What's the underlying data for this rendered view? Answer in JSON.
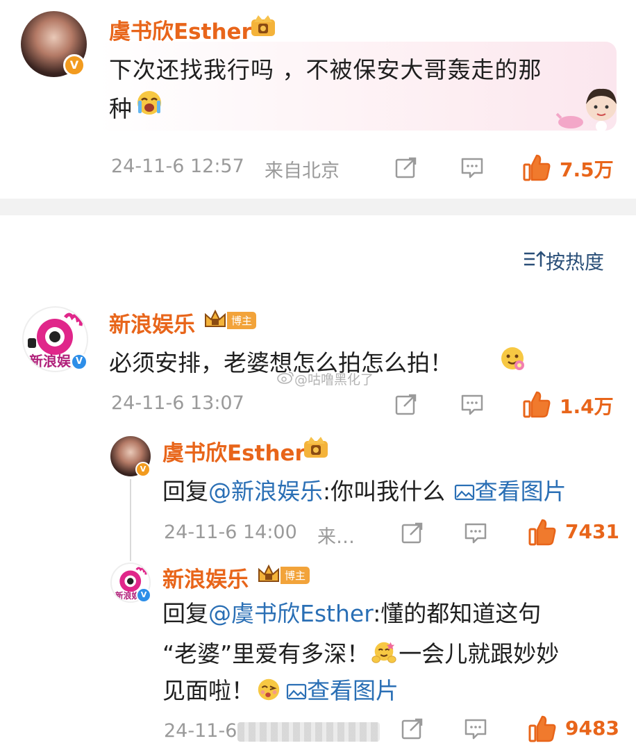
{
  "comments": [
    {
      "name": "虞书欣Esther",
      "text_line1": "下次还找我行吗 ，不被保安大哥轰走的那",
      "text_line2": "种",
      "time": "24-11-6 12:57",
      "location": "来自北京",
      "likes": "7.5万"
    },
    {
      "name": "新浪娱乐",
      "host_badge": "博主",
      "text": "必须安排，老婆想怎么拍怎么拍！",
      "time": "24-11-6 13:07",
      "likes": "1.4万"
    }
  ],
  "sort": {
    "label": "按热度"
  },
  "replies": [
    {
      "name": "虞书欣Esther",
      "reply_prefix": "回复",
      "mention": "@新浪娱乐",
      "text": ":你叫我什么",
      "image_link": "查看图片",
      "time": "24-11-6 14:00",
      "location_trunc": "来…",
      "likes": "7431"
    },
    {
      "name": "新浪娱乐",
      "host_badge": "博主",
      "reply_prefix": "回复",
      "mention": "@虞书欣Esther",
      "text_line1": ":懂的都知道这句",
      "text_line2a": "“老婆”里爱有多深！",
      "text_line2b": "一会儿就跟妙妙",
      "text_line3": "见面啦！",
      "image_link": "查看图片",
      "time": "24-11-6",
      "likes": "9483"
    }
  ],
  "watermark": "@咕噜黑化了",
  "colors": {
    "accent": "#e8651a",
    "link": "#2a6fb5",
    "meta": "#9a9a9a"
  }
}
